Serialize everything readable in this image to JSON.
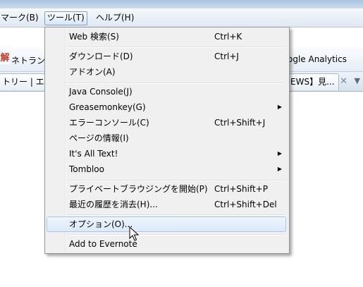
{
  "menubar": {
    "bookmarks_label": "マーク(B)",
    "tools_label": "ツール(T)",
    "help_label": "ヘルプ(H)"
  },
  "bookmarks": {
    "icon_text": "解",
    "item1": "ネトラン",
    "item2": "ogle Analytics"
  },
  "tabs": {
    "tab1": "トリー | エ",
    "tab2": "EWS】見..."
  },
  "menu": {
    "items": [
      {
        "label": "Web 検索(S)",
        "shortcut": "Ctrl+K"
      },
      {
        "label": "ダウンロード(D)",
        "shortcut": "Ctrl+J"
      },
      {
        "label": "アドオン(A)",
        "shortcut": ""
      },
      {
        "label": "Java Console(J)",
        "shortcut": ""
      },
      {
        "label": "Greasemonkey(G)",
        "shortcut": "",
        "submenu": true
      },
      {
        "label": "エラーコンソール(C)",
        "shortcut": "Ctrl+Shift+J"
      },
      {
        "label": "ページの情報(I)",
        "shortcut": ""
      },
      {
        "label": "It's All Text!",
        "shortcut": "",
        "submenu": true
      },
      {
        "label": "Tombloo",
        "shortcut": "",
        "submenu": true
      },
      {
        "label": "プライベートブラウジングを開始(P)",
        "shortcut": "Ctrl+Shift+P"
      },
      {
        "label": "最近の履歴を消去(H)...",
        "shortcut": "Ctrl+Shift+Del"
      },
      {
        "label": "オプション(O)...",
        "shortcut": "",
        "highlighted": true
      },
      {
        "label": "Add to Evernote",
        "shortcut": ""
      }
    ]
  },
  "icons": {
    "submenu_arrow": "triangle-right-icon",
    "tab_close": "close-icon",
    "tab_scroll": "chevron-down-icon",
    "cursor": "mouse-pointer-icon"
  },
  "colors": {
    "menu_bg": "#f0f0f0",
    "highlight_border": "#a8c8eb",
    "menubar_active_border": "#7da2ce"
  }
}
